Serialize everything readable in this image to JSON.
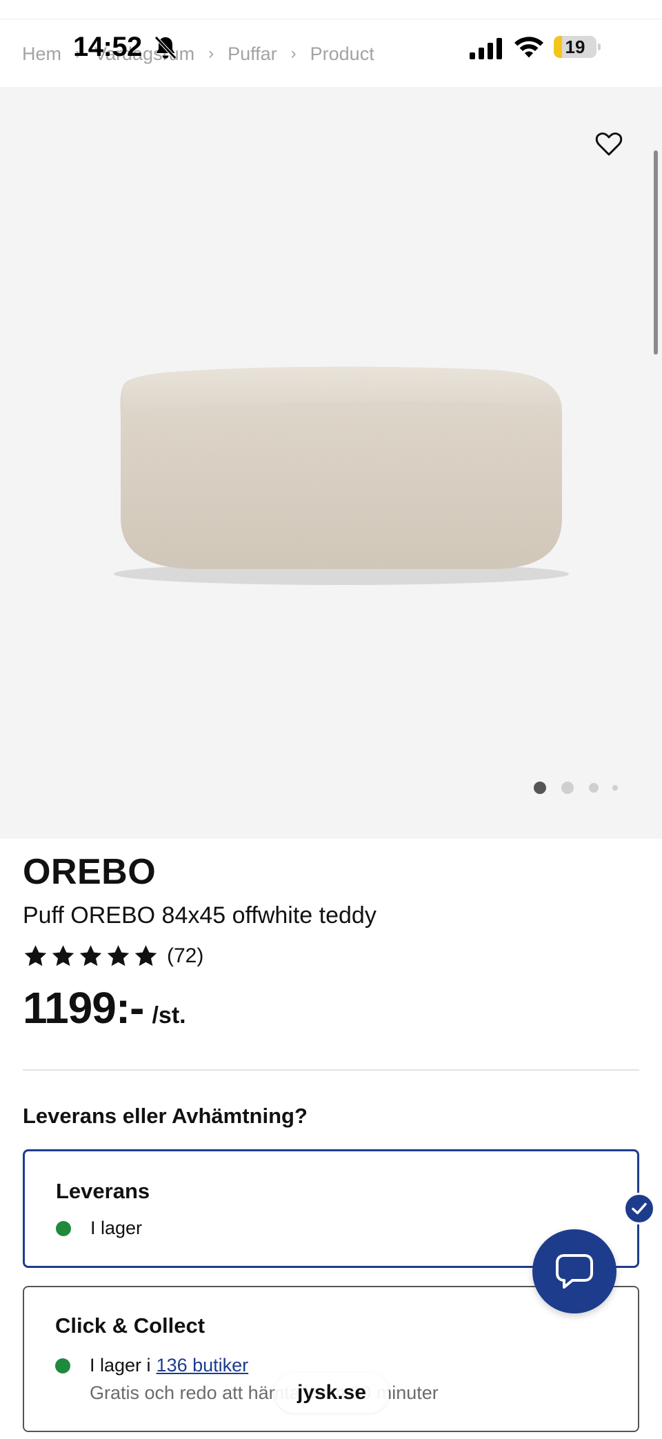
{
  "status_bar": {
    "time": "14:52",
    "battery_level": "19",
    "battery_fraction": 0.19,
    "battery_color": "#f5c518"
  },
  "breadcrumb": {
    "items": [
      "Hem",
      "Vardagsrum",
      "Puffar",
      "Product"
    ]
  },
  "gallery": {
    "image_count": 4,
    "active_index": 0,
    "favorite_icon": "heart-outline-icon"
  },
  "product": {
    "brand": "OREBO",
    "name": "Puff OREBO 84x45 offwhite teddy",
    "rating": 5,
    "review_count": "(72)",
    "price": "1199:-",
    "price_unit": "/st."
  },
  "delivery": {
    "question": "Leverans eller Avhämtning?",
    "options": [
      {
        "title": "Leverans",
        "stock_text": "I lager",
        "selected": true
      },
      {
        "title": "Click & Collect",
        "stock_prefix": "I lager i",
        "stores_link": "136 butiker",
        "note": "Gratis och redo att hämta inom 30 minuter",
        "selected": false
      }
    ]
  },
  "browser": {
    "url": "jysk.se"
  },
  "colors": {
    "accent": "#1d3c8c",
    "in_stock": "#1f8a3c",
    "gallery_bg": "#f4f4f4"
  }
}
